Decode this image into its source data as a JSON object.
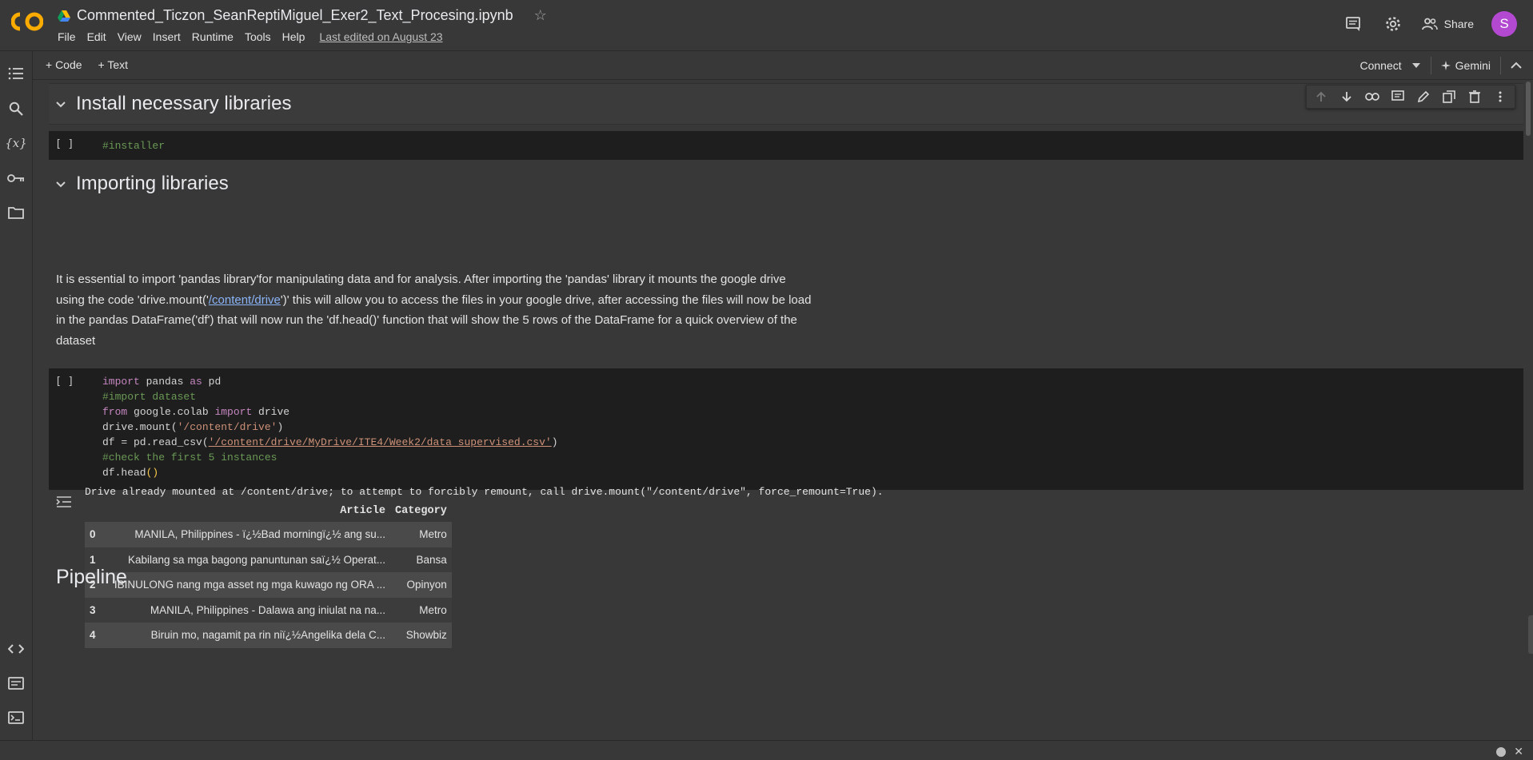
{
  "notebook": {
    "title": "Commented_Ticzon_SeanReptiMiguel_Exer2_Text_Procesing.ipynb",
    "last_edited": "Last edited on August 23"
  },
  "menu": [
    "File",
    "Edit",
    "View",
    "Insert",
    "Runtime",
    "Tools",
    "Help"
  ],
  "header": {
    "share_label": "Share",
    "avatar_initial": "S",
    "avatar_color": "#b349d1"
  },
  "toolbar": {
    "add_code": "+ Code",
    "add_text": "+ Text",
    "connect": "Connect",
    "gemini": "Gemini"
  },
  "sections": {
    "install_heading": "Install necessary libraries",
    "importing_heading": "Importing libraries",
    "pipeline_heading": "Pipeline"
  },
  "cells": {
    "run_bracket": "[ ]",
    "installer_code": "#installer"
  },
  "paragraph": {
    "line1": "It is essential to import 'pandas library'for manipulating data and for analysis. After importing the 'pandas' library it mounts the google drive",
    "line2_prefix": "using the code 'drive.mount('",
    "line2_link": "/content/drive",
    "line2_suffix": "')' this will allow you to access the files in your google drive, after accessing the files will now be load",
    "line3": "in the pandas DataFrame('df') that will now run the 'df.head()' function that will show the 5 rows of the DataFrame for a quick overview of the",
    "line4": "dataset"
  },
  "code": {
    "l1_kw1": "import",
    "l1_mid": " pandas ",
    "l1_kw2": "as",
    "l1_end": " pd",
    "l2": "#import dataset",
    "l3_kw1": "from",
    "l3_mid": " google.colab ",
    "l3_kw2": "import",
    "l3_end": " drive",
    "l4_pre": "drive.mount(",
    "l4_str": "'/content/drive'",
    "l4_end": ")",
    "l5_pre": "df = pd.read_csv(",
    "l5_str": "'/content/drive/MyDrive/ITE4/Week2/data_supervised.csv'",
    "l5_end": ")",
    "l6": "#check the first 5 instances",
    "l7_pre": "df.head",
    "l7_paren": "()"
  },
  "output": {
    "message": "Drive already mounted at /content/drive; to attempt to forcibly remount, call drive.mount(\"/content/drive\", force_remount=True).",
    "columns": [
      "Article",
      "Category"
    ],
    "rows": [
      {
        "index": "0",
        "article": "MANILA, Philippines - ï¿½Bad morningï¿½ ang su...",
        "category": "Metro"
      },
      {
        "index": "1",
        "article": "Kabilang sa mga bagong panuntunan saï¿½ Operat...",
        "category": "Bansa"
      },
      {
        "index": "2",
        "article": "IBINULONG nang mga asset ng mga kuwago ng ORA ...",
        "category": "Opinyon"
      },
      {
        "index": "3",
        "article": "MANILA, Philippines - Dalawa ang iniulat na na...",
        "category": "Metro"
      },
      {
        "index": "4",
        "article": "Biruin mo, nagamit pa rin niï¿½Angelika dela C...",
        "category": "Showbiz"
      }
    ]
  },
  "icons": [
    "colab-logo",
    "drive-icon",
    "star-icon",
    "comment-icon",
    "gear-icon",
    "people-icon",
    "toc-icon",
    "search-icon",
    "variables-icon",
    "key-icon",
    "folder-icon",
    "code-snippets-icon",
    "command-palette-icon",
    "terminal-icon",
    "arrow-up-icon",
    "arrow-down-icon",
    "link-icon",
    "comment-icon",
    "edit-icon",
    "mirror-icon",
    "delete-icon",
    "more-icon",
    "chevron-down-icon",
    "chevron-up-icon",
    "sparkle-icon",
    "close-icon"
  ]
}
